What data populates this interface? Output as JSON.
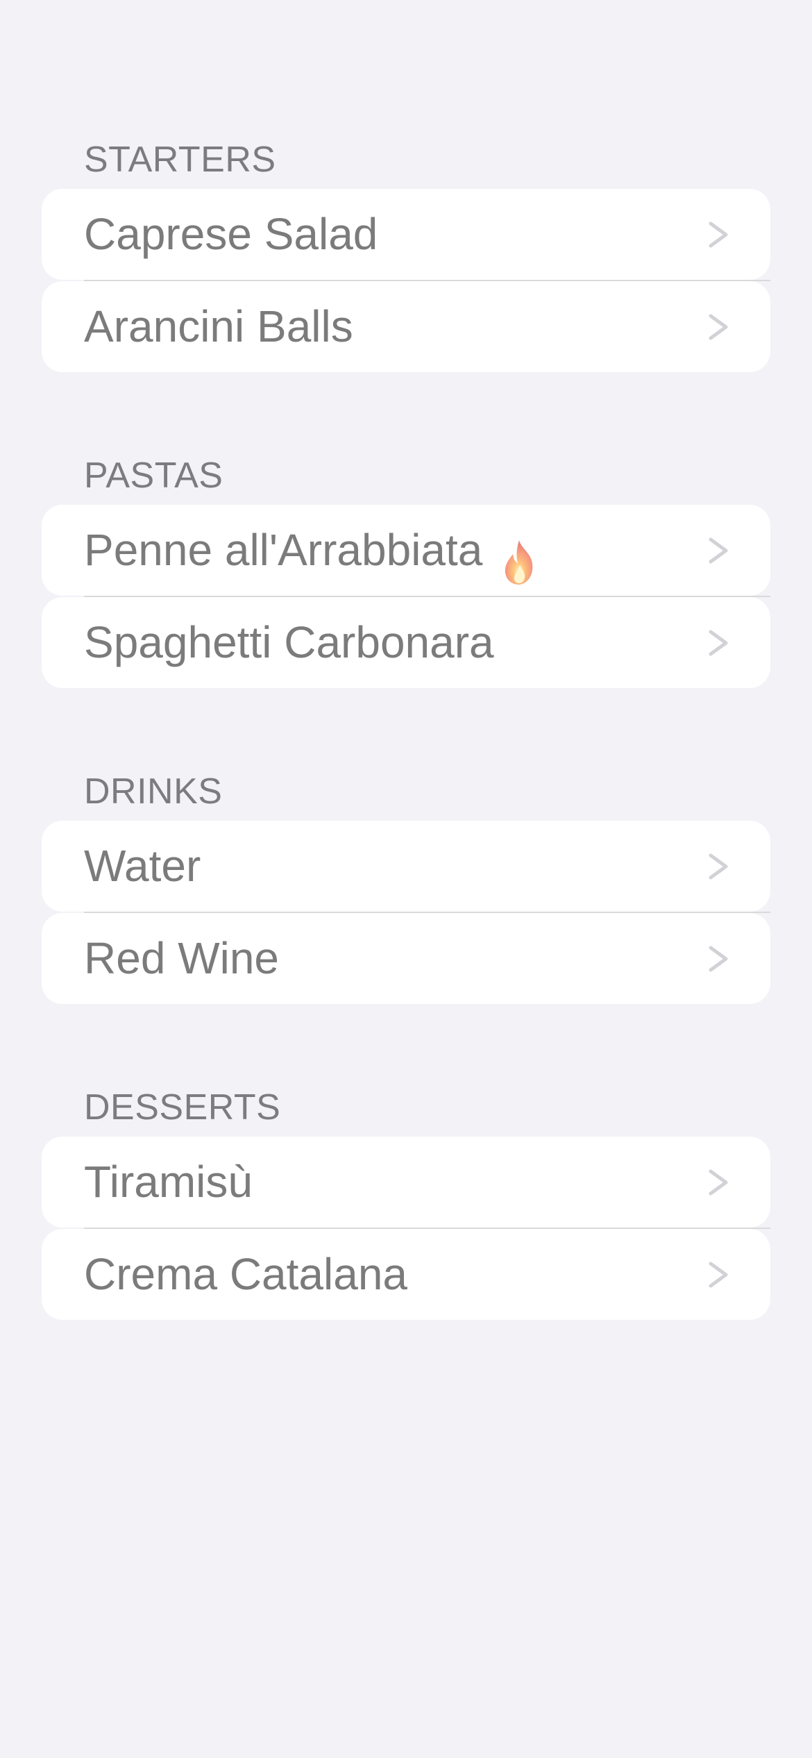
{
  "sections": [
    {
      "header": "STARTERS",
      "items": [
        {
          "label": "Caprese Salad"
        },
        {
          "label": "Arancini Balls"
        }
      ]
    },
    {
      "header": "PASTAS",
      "items": [
        {
          "label": "Penne all'Arrabbiata",
          "badge_icon": "fire-icon"
        },
        {
          "label": "Spaghetti Carbonara"
        }
      ]
    },
    {
      "header": "DRINKS",
      "items": [
        {
          "label": "Water"
        },
        {
          "label": "Red Wine"
        }
      ]
    },
    {
      "header": "DESSERTS",
      "items": [
        {
          "label": "Tiramisù"
        },
        {
          "label": "Crema Catalana"
        }
      ]
    }
  ],
  "colors": {
    "background": "#f2f2f7",
    "row_background": "#ffffff",
    "header_text": "#7c7c80",
    "row_text": "#7b7b7b",
    "chevron": "#d1d1d6",
    "divider": "#d9d9dc"
  }
}
